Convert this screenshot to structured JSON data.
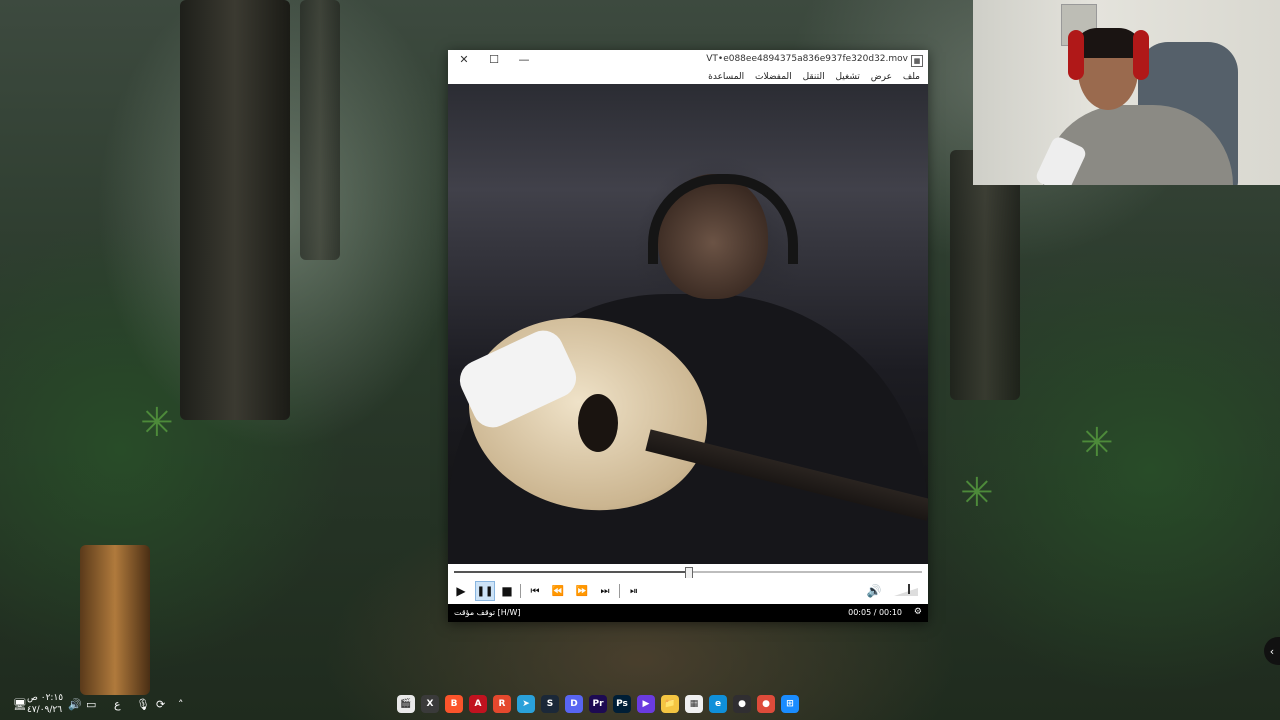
{
  "desktop": {
    "wallpaper": "forest-wallpaper"
  },
  "player": {
    "filename": "VT•e088ee4894375a836e937fe320d32.mov",
    "menu": [
      "ملف",
      "عرض",
      "تشغيل",
      "التنقل",
      "المفضلات",
      "المساعدة"
    ],
    "status_text": "توقف مؤقت [H/W]",
    "time_text": "00:05 / 00:10",
    "progress_fraction": 0.5,
    "controls": {
      "play": "▶",
      "pause": "❚❚",
      "stop": "■",
      "prev": "⏮",
      "rewind": "⏪",
      "forward": "⏩",
      "next": "⏭",
      "frame_step": "⏯",
      "volume": "🔊"
    }
  },
  "taskbar": {
    "clock_time": "٠٢:١٥ ص",
    "clock_date": "٤٧/٠٩/٢٦",
    "language": "ع",
    "apps": [
      {
        "icon": "clapper-icon",
        "label": "🎬",
        "color": "#e9e9e9"
      },
      {
        "icon": "xbox-icon",
        "label": "X",
        "color": "#3a3a3a"
      },
      {
        "icon": "brave-icon",
        "label": "B",
        "color": "#fb542b"
      },
      {
        "icon": "acrobat-icon",
        "label": "A",
        "color": "#c1121f"
      },
      {
        "icon": "app-red-icon",
        "label": "R",
        "color": "#e5482d"
      },
      {
        "icon": "telegram-icon",
        "label": "➤",
        "color": "#2aa1da"
      },
      {
        "icon": "steam-icon",
        "label": "S",
        "color": "#1b2838"
      },
      {
        "icon": "discord-icon",
        "label": "D",
        "color": "#5865f2"
      },
      {
        "icon": "premiere-icon",
        "label": "Pr",
        "color": "#1d0a52"
      },
      {
        "icon": "photoshop-icon",
        "label": "Ps",
        "color": "#001e36"
      },
      {
        "icon": "media-player-icon",
        "label": "▶",
        "color": "#6a3be0"
      },
      {
        "icon": "file-explorer-icon",
        "label": "📁",
        "color": "#f4c542"
      },
      {
        "icon": "store-icon",
        "label": "▦",
        "color": "#f0f0f0"
      },
      {
        "icon": "edge-icon",
        "label": "e",
        "color": "#0f8fd9"
      },
      {
        "icon": "obs-icon",
        "label": "●",
        "color": "#302e31"
      },
      {
        "icon": "chrome-icon",
        "label": "●",
        "color": "#de4b3a"
      },
      {
        "icon": "start-icon",
        "label": "⊞",
        "color": "#1a8cff"
      }
    ]
  }
}
